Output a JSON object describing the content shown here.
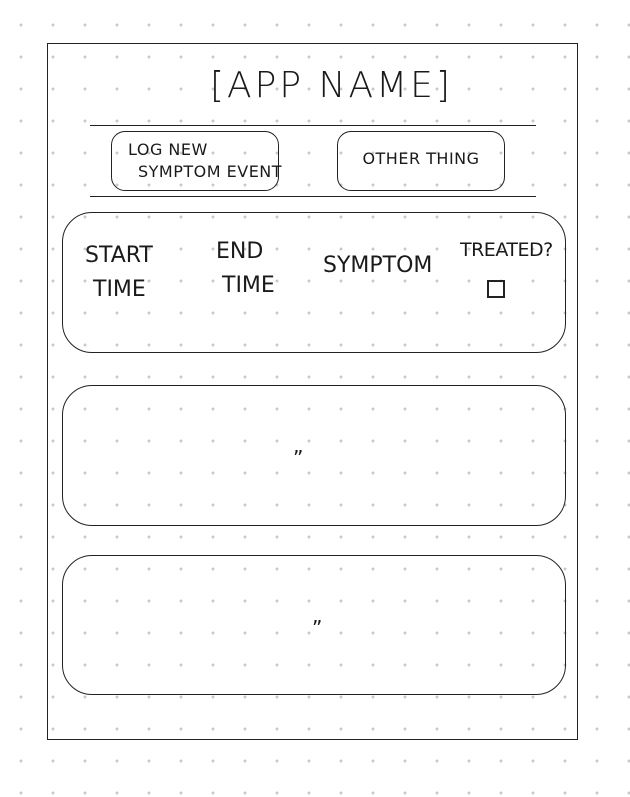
{
  "app": {
    "title": "[APP NAME]"
  },
  "toolbar": {
    "log_button_line1": "LOG NEW",
    "log_button_line2": "SYMPTOM EVENT",
    "other_button_label": "OTHER THING"
  },
  "event_list": {
    "header": {
      "start_line1": "START",
      "start_line2": "TIME",
      "end_line1": "END",
      "end_line2": "TIME",
      "symptom": "SYMPTOM",
      "treated": "TREATED?"
    },
    "treated_checked": false,
    "rows": [
      {
        "ditto": "”"
      },
      {
        "ditto": "”"
      }
    ]
  }
}
